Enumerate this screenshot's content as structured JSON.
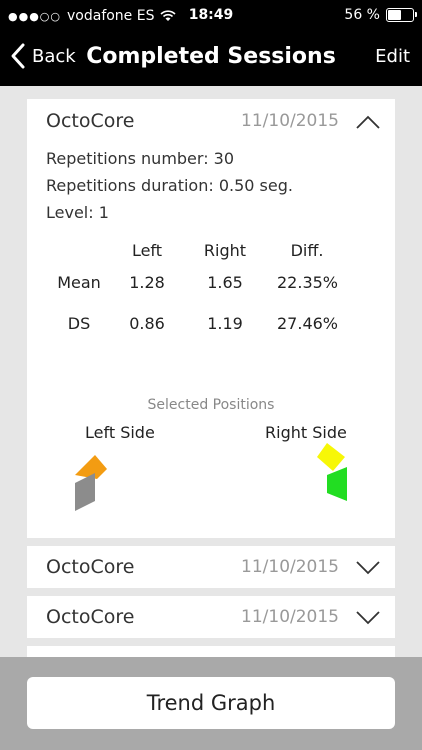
{
  "status": {
    "carrier": "vodafone ES",
    "time": "18:49",
    "battery": "56 %",
    "battery_level": 0.56
  },
  "nav": {
    "back_label": "Back",
    "title": "Completed Sessions",
    "edit_label": "Edit"
  },
  "sessions": [
    {
      "name": "OctoCore",
      "date": "11/10/2015",
      "expanded": true,
      "repetitions": "Repetitions number: 30",
      "duration": "Repetitions duration: 0.50 seg.",
      "level": "Level: 1",
      "table": {
        "headers": [
          "Left",
          "Right",
          "Diff."
        ],
        "rows": [
          {
            "label": "Mean",
            "left": "1.28",
            "right": "1.65",
            "diff": "22.35%"
          },
          {
            "label": "DS",
            "left": "0.86",
            "right": "1.19",
            "diff": "27.46%"
          }
        ]
      },
      "selected_positions_label": "Selected Positions",
      "left_side_label": "Left Side",
      "right_side_label": "Right Side",
      "colors": {
        "left_top": "#F39C12",
        "left_bottom": "#8C8C8C",
        "right_top": "#F7F707",
        "right_bottom": "#22DD22"
      }
    },
    {
      "name": "OctoCore",
      "date": "11/10/2015",
      "expanded": false
    },
    {
      "name": "OctoCore",
      "date": "11/10/2015",
      "expanded": false
    }
  ],
  "trend_button": "Trend Graph"
}
